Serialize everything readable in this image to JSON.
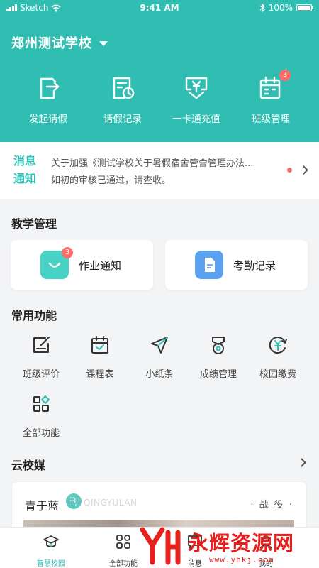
{
  "status_bar": {
    "carrier": "Sketch",
    "time": "9:41 AM",
    "battery": "100%"
  },
  "header": {
    "school_name": "郑州测试学校",
    "actions": [
      {
        "label": "发起请假",
        "icon": "leave-request-icon"
      },
      {
        "label": "请假记录",
        "icon": "leave-records-icon"
      },
      {
        "label": "一卡通充值",
        "icon": "card-recharge-icon"
      },
      {
        "label": "班级管理",
        "icon": "class-management-icon",
        "badge": "3"
      }
    ],
    "bg_color": "#30bdb2"
  },
  "notice": {
    "title_line1": "消息",
    "title_line2": "通知",
    "line1": "关于加强《测试学校关于暑假宿舍管舍管理办法...",
    "line2": "如初的审核已通过，请查收。"
  },
  "teaching": {
    "title": "教学管理",
    "cards": [
      {
        "label": "作业通知",
        "icon": "homework-icon",
        "badge": "3",
        "color": "#46d2c4"
      },
      {
        "label": "考勤记录",
        "icon": "attendance-icon",
        "color": "#5aa2f0"
      }
    ]
  },
  "common": {
    "title": "常用功能",
    "items": [
      {
        "label": "班级评价",
        "icon": "class-evaluation-icon"
      },
      {
        "label": "课程表",
        "icon": "calendar-icon"
      },
      {
        "label": "小纸条",
        "icon": "paper-plane-icon"
      },
      {
        "label": "成绩管理",
        "icon": "medal-icon"
      },
      {
        "label": "校园缴费",
        "icon": "yuan-payment-icon"
      },
      {
        "label": "全部功能",
        "icon": "all-functions-icon"
      }
    ]
  },
  "media": {
    "title": "云校媒",
    "card_name": "青于蓝",
    "logo_char": "刊",
    "card_en": "QINGYULAN",
    "card_tag": "· 战 役 ·"
  },
  "tabbar": {
    "tabs": [
      {
        "label": "智慧校园",
        "icon": "graduation-cap-icon",
        "active": true
      },
      {
        "label": "全部功能",
        "icon": "grid-icon"
      },
      {
        "label": "消息",
        "icon": "message-icon"
      },
      {
        "label": "我的",
        "icon": "profile-icon"
      }
    ]
  },
  "watermark": {
    "text": "永辉资源网",
    "url": "www.yhkj.com"
  }
}
